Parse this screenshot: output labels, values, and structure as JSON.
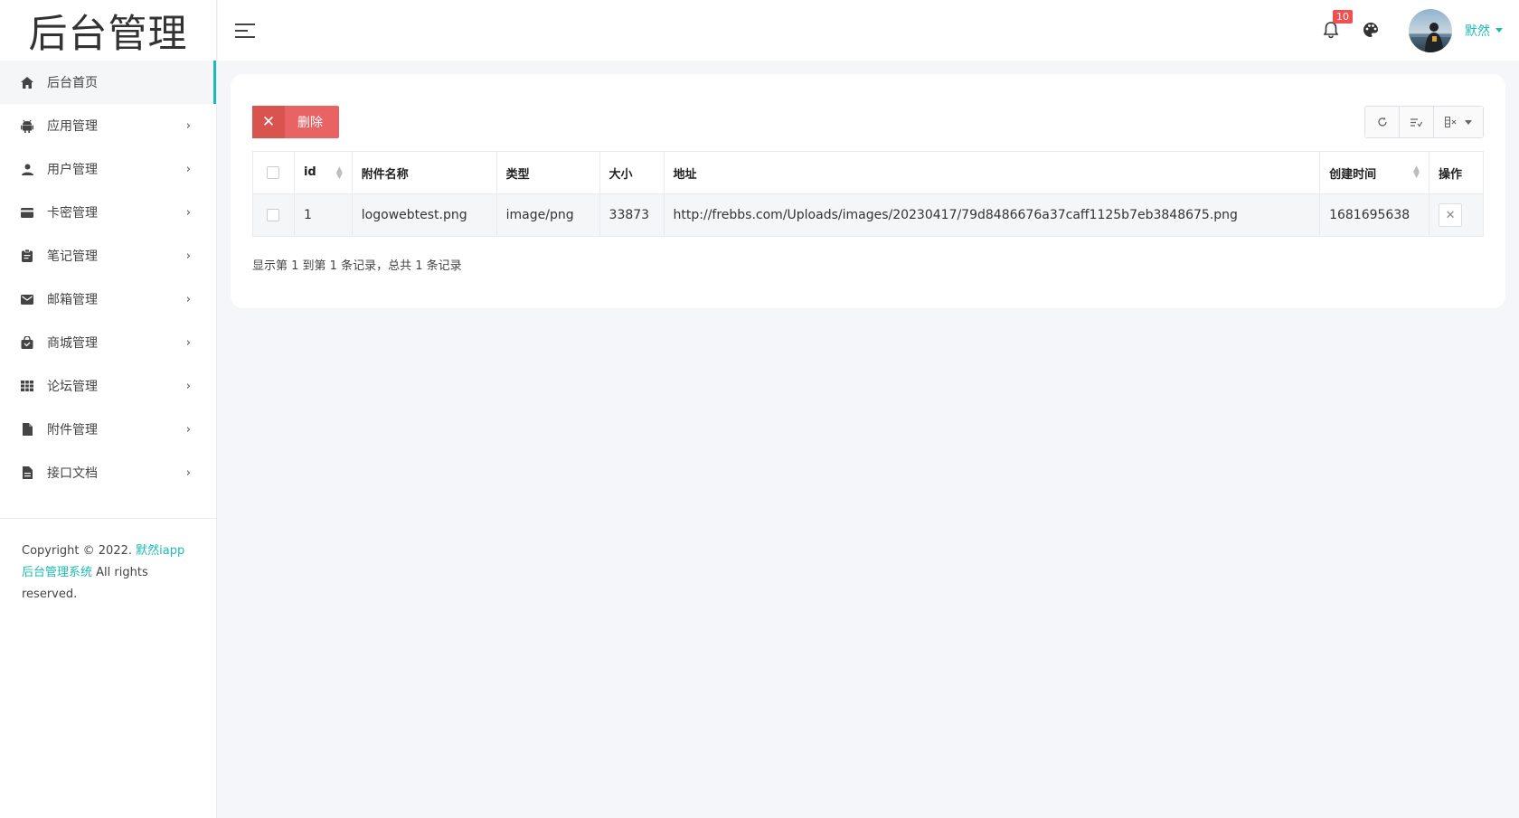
{
  "brand": {
    "logo_text": "后台管理"
  },
  "sidebar": {
    "items": [
      {
        "label": "后台首页",
        "icon": "home-icon",
        "active": true
      },
      {
        "label": "应用管理",
        "icon": "android-icon"
      },
      {
        "label": "用户管理",
        "icon": "user-icon"
      },
      {
        "label": "卡密管理",
        "icon": "card-icon"
      },
      {
        "label": "笔记管理",
        "icon": "clipboard-icon"
      },
      {
        "label": "邮箱管理",
        "icon": "mail-icon"
      },
      {
        "label": "商城管理",
        "icon": "shop-icon"
      },
      {
        "label": "论坛管理",
        "icon": "grid-icon"
      },
      {
        "label": "附件管理",
        "icon": "file-icon"
      },
      {
        "label": "接口文档",
        "icon": "doc-icon"
      }
    ],
    "chevron": "›",
    "copyright_prefix": "Copyright © 2022.",
    "copyright_brand": "默然iapp后台管理系统",
    "copyright_suffix": "All rights reserved."
  },
  "header": {
    "notification_count": "10",
    "username": "默然"
  },
  "toolbar": {
    "delete_label": "删除",
    "delete_icon": "✕"
  },
  "table": {
    "columns": [
      "id",
      "附件名称",
      "类型",
      "大小",
      "地址",
      "创建时间",
      "操作"
    ],
    "rows": [
      {
        "id": "1",
        "name": "logowebtest.png",
        "type": "image/png",
        "size": "33873",
        "url": "http://frebbs.com/Uploads/images/20230417/79d8486676a37caff1125b7eb3848675.png",
        "created": "1681695638"
      }
    ],
    "page_info": "显示第 1 到第 1 条记录，总共 1 条记录"
  },
  "colors": {
    "accent": "#1cbbb4",
    "danger": "#e96365",
    "badge": "#f05050"
  }
}
